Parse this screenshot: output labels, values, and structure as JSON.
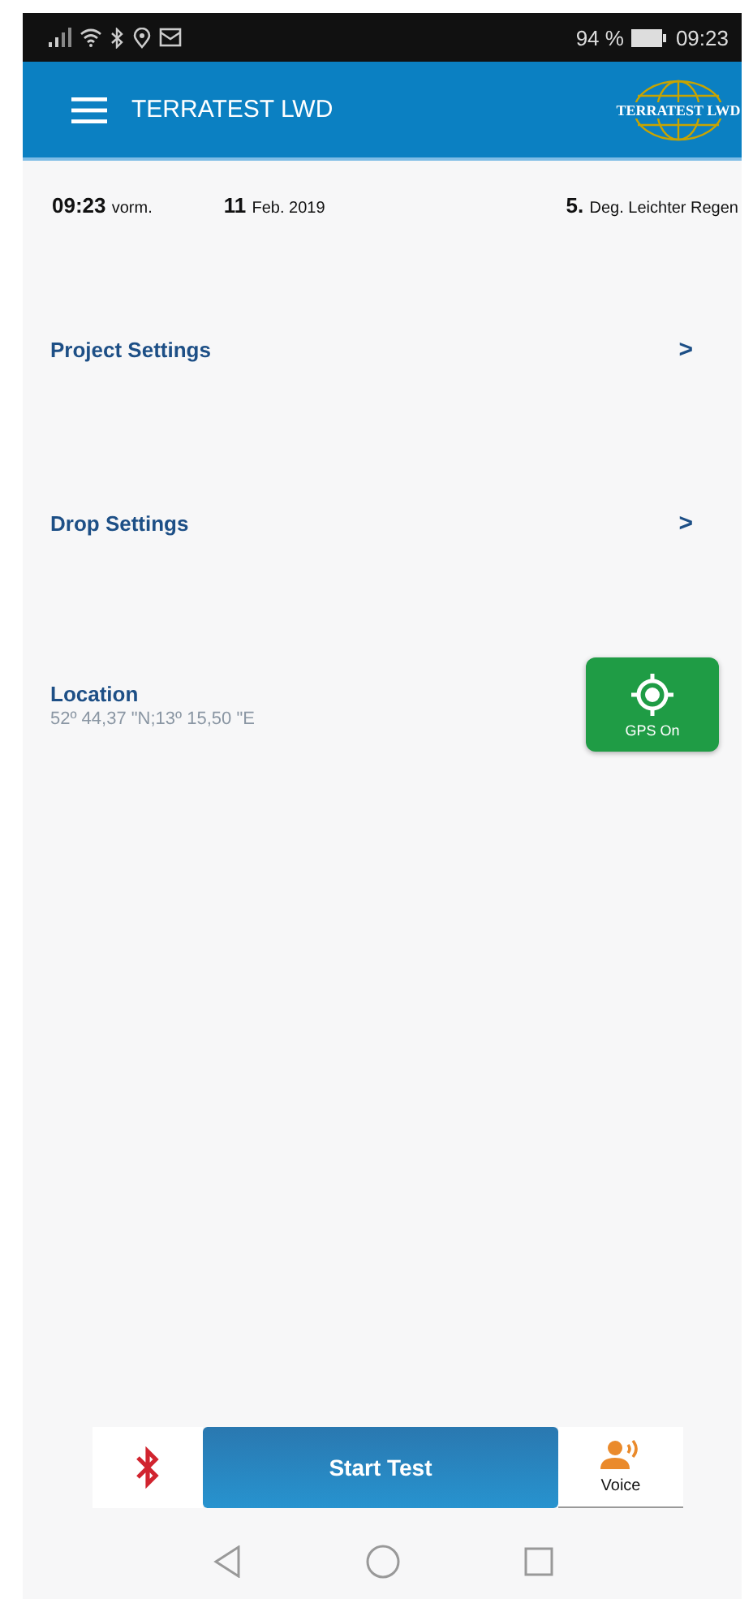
{
  "status_bar": {
    "battery": "94 %",
    "time": "09:23"
  },
  "app_bar": {
    "title": "TERRATEST LWD",
    "logo": "TERRATEST LWD"
  },
  "info_row": {
    "time": "09:23",
    "time_suffix": "vorm.",
    "day": "11",
    "month_year": "Feb. 2019",
    "temp": "5.",
    "weather": "Deg. Leichter Regen"
  },
  "settings": [
    {
      "label": "Project Settings",
      "chevron": ">"
    },
    {
      "label": "Drop Settings",
      "chevron": ">"
    }
  ],
  "location": {
    "label": "Location",
    "coords": "52º 44,37 \"N;13º 15,50 \"E",
    "gps_button": "GPS On",
    "gps_on": true
  },
  "bottom_bar": {
    "start_button": "Start Test",
    "voice": "Voice",
    "bluetooth_connected": false
  }
}
